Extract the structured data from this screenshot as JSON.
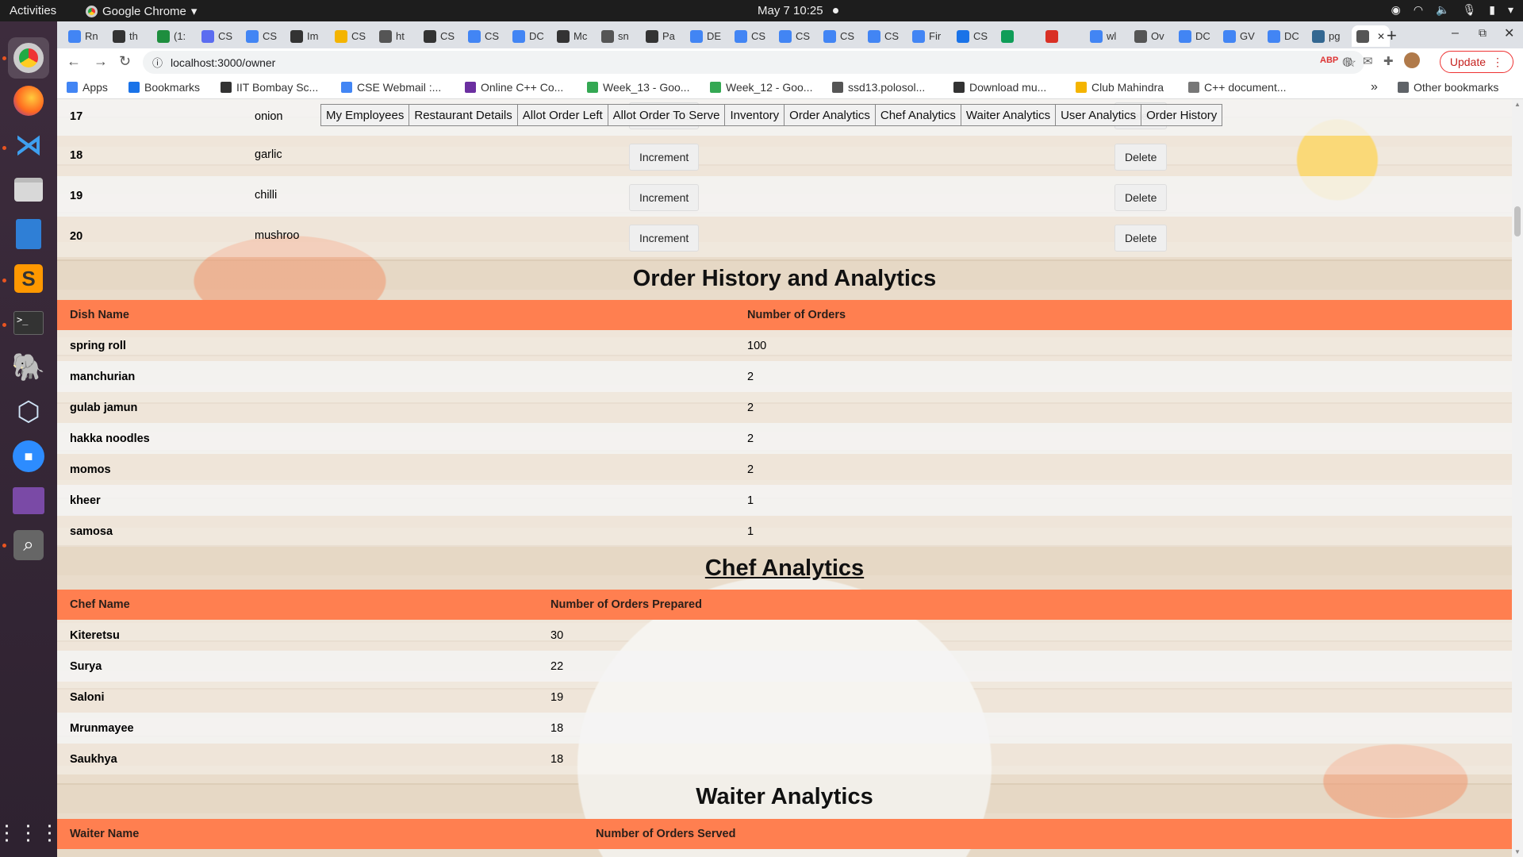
{
  "system": {
    "activities": "Activities",
    "app_name": "Google Chrome",
    "clock": "May 7  10:25"
  },
  "browser": {
    "tabs": [
      "Rn",
      "th",
      "(1:",
      "CS",
      "CS",
      "Im",
      "CS",
      "ht",
      "CS",
      "CS",
      "DC",
      "Mc",
      "sn",
      "Pa",
      "DE",
      "CS",
      "CS",
      "CS",
      "CS",
      "Fir",
      "CS",
      "",
      "",
      "wl",
      "Ov",
      "DC",
      "GV",
      "DC",
      "pg",
      ""
    ],
    "url": "localhost:3000/owner",
    "update_label": "Update",
    "bookmarks": [
      "Apps",
      "Bookmarks",
      "IIT Bombay Sc...",
      "CSE Webmail :...",
      "Online C++ Co...",
      "Week_13 - Goo...",
      "Week_12 - Goo...",
      "ssd13.polosol...",
      "Download mu...",
      "Club Mahindra",
      "C++ document..."
    ],
    "other_bookmarks": "Other bookmarks",
    "chevron": "»"
  },
  "nav": {
    "buttons": [
      "My Employees",
      "Restaurant Details",
      "Allot Order Left",
      "Allot Order To Serve",
      "Inventory",
      "Order Analytics",
      "Chef Analytics",
      "Waiter Analytics",
      "User Analytics",
      "Order History"
    ]
  },
  "inventory": {
    "increment_label": "Increment",
    "delete_label": "Delete",
    "rows": [
      {
        "id": "17",
        "item": "onion"
      },
      {
        "id": "18",
        "item": "garlic"
      },
      {
        "id": "19",
        "item": "chilli"
      },
      {
        "id": "20",
        "item": "mushroo"
      }
    ]
  },
  "order_history": {
    "title": "Order History and Analytics",
    "headers": [
      "Dish Name",
      "Number of Orders"
    ],
    "rows": [
      {
        "name": "spring roll",
        "count": "100"
      },
      {
        "name": "manchurian",
        "count": "2"
      },
      {
        "name": "gulab jamun",
        "count": "2"
      },
      {
        "name": "hakka noodles",
        "count": "2"
      },
      {
        "name": "momos",
        "count": "2"
      },
      {
        "name": "kheer",
        "count": "1"
      },
      {
        "name": "samosa",
        "count": "1"
      }
    ]
  },
  "chef_analytics": {
    "title": "Chef Analytics",
    "headers": [
      "Chef Name",
      "Number of Orders Prepared"
    ],
    "rows": [
      {
        "name": "Kiteretsu",
        "count": "30"
      },
      {
        "name": "Surya",
        "count": "22"
      },
      {
        "name": "Saloni",
        "count": "19"
      },
      {
        "name": "Mrunmayee",
        "count": "18"
      },
      {
        "name": "Saukhya",
        "count": "18"
      }
    ]
  },
  "waiter_analytics": {
    "title": "Waiter Analytics",
    "headers": [
      "Waiter Name",
      "Number of Orders Served"
    ]
  }
}
